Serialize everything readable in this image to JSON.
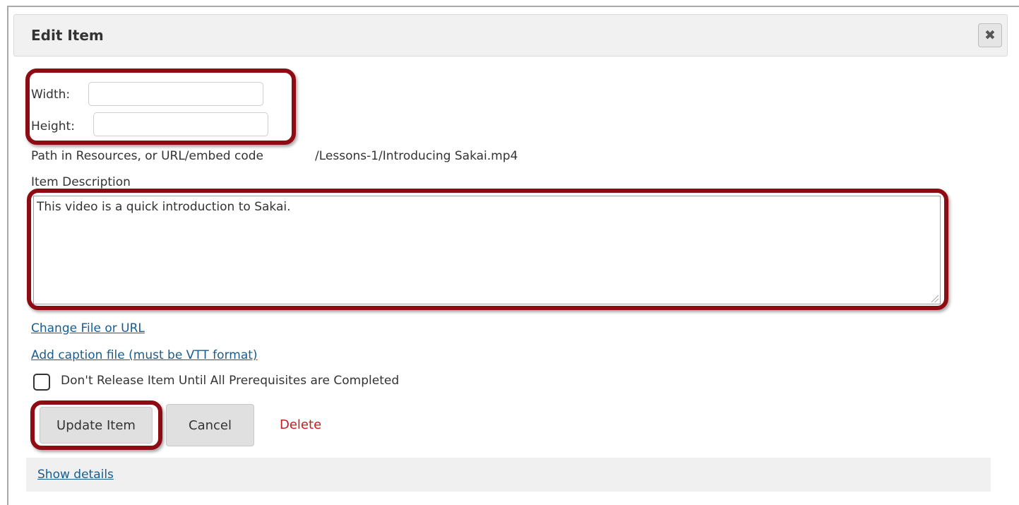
{
  "dialog": {
    "title": "Edit Item",
    "close_icon": "close-icon"
  },
  "form": {
    "width_label": "Width:",
    "width_value": "",
    "height_label": "Height:",
    "height_value": "",
    "path_label": "Path in Resources, or URL/embed code",
    "path_value": "/Lessons-1/Introducing Sakai.mp4",
    "description_label": "Item Description",
    "description_value": "This video is a quick introduction to Sakai.",
    "change_file_link": "Change File or URL",
    "caption_link": "Add caption file (must be VTT format)",
    "prerequisite_label": "Don't Release Item Until All Prerequisites are Completed",
    "prerequisite_checked": false
  },
  "actions": {
    "update_label": "Update Item",
    "cancel_label": "Cancel",
    "delete_label": "Delete"
  },
  "footer": {
    "show_details_link": "Show details"
  },
  "colors": {
    "highlight": "#8e0b13",
    "link": "#1a5c8c",
    "delete": "#c41e1e"
  }
}
